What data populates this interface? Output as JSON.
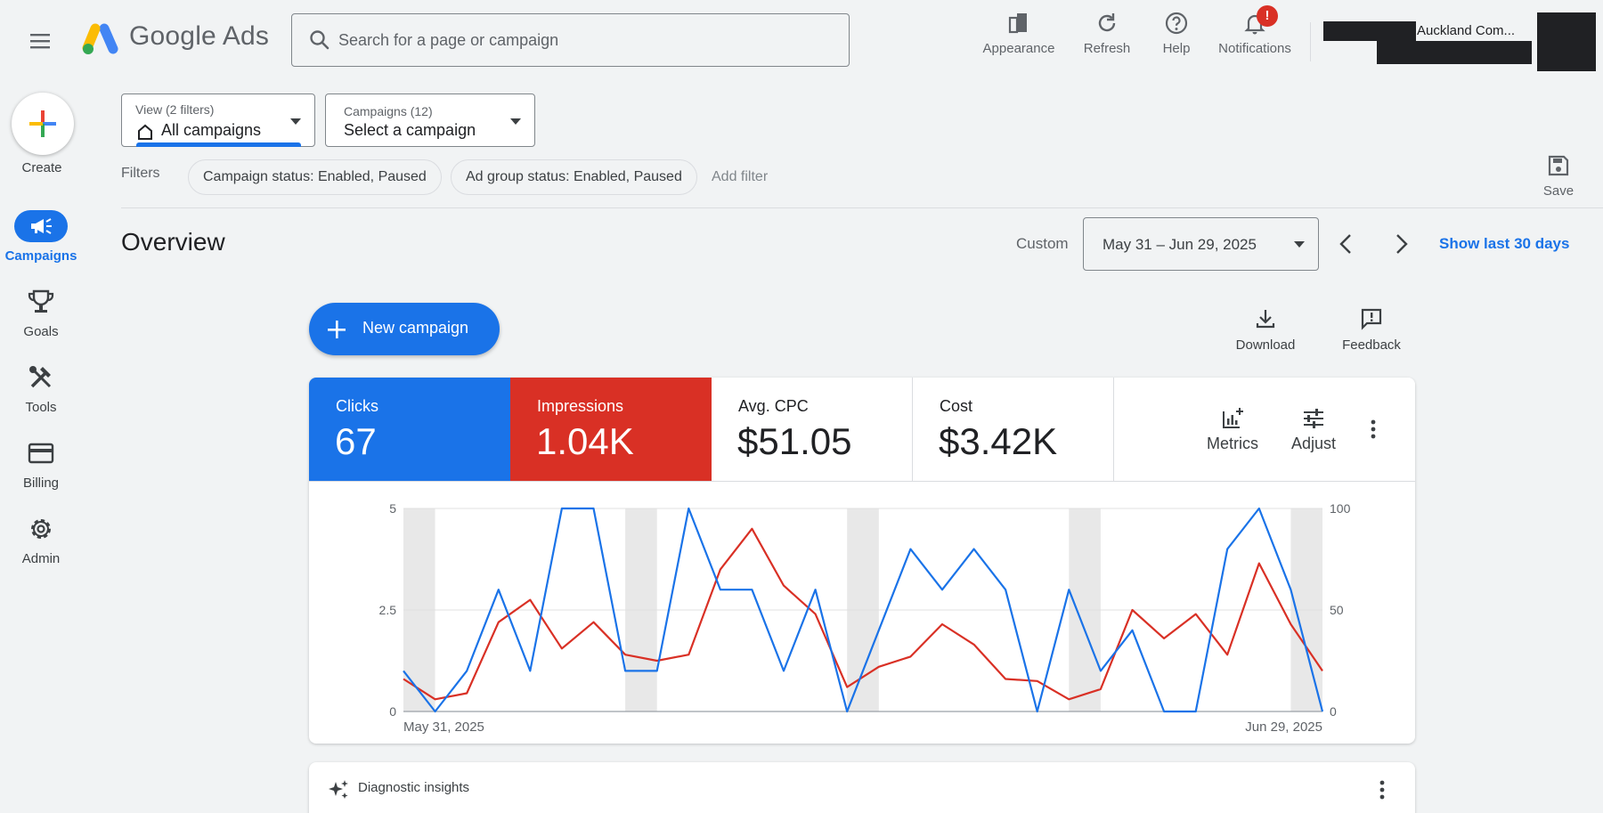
{
  "app": {
    "product_name": "Google Ads"
  },
  "search": {
    "placeholder": "Search for a page or campaign"
  },
  "header": {
    "appearance_label": "Appearance",
    "refresh_label": "Refresh",
    "help_label": "Help",
    "notifications_label": "Notifications",
    "notifications_badge": "!",
    "account_name": "Auckland Com..."
  },
  "nav": {
    "create_label": "Create",
    "items": [
      {
        "label": "Campaigns",
        "icon": "megaphone-icon",
        "active": true
      },
      {
        "label": "Goals",
        "icon": "trophy-icon"
      },
      {
        "label": "Tools",
        "icon": "tools-icon"
      },
      {
        "label": "Billing",
        "icon": "credit-card-icon"
      },
      {
        "label": "Admin",
        "icon": "gear-icon"
      }
    ]
  },
  "pickers": {
    "view_small": "View (2 filters)",
    "view_value": "All campaigns",
    "campaign_small": "Campaigns (12)",
    "campaign_value": "Select a campaign"
  },
  "filters": {
    "label": "Filters",
    "chips": [
      "Campaign status: Enabled, Paused",
      "Ad group status: Enabled, Paused"
    ],
    "add_filter": "Add filter",
    "save_label": "Save"
  },
  "overview": {
    "title": "Overview",
    "custom_label": "Custom",
    "date_range": "May 31 – Jun 29, 2025",
    "show_last": "Show last 30 days"
  },
  "actions": {
    "new_campaign": "New campaign",
    "download": "Download",
    "feedback": "Feedback"
  },
  "metrics": {
    "clicks_label": "Clicks",
    "clicks_value": "67",
    "impressions_label": "Impressions",
    "impressions_value": "1.04K",
    "cpc_label": "Avg. CPC",
    "cpc_value": "$51.05",
    "cost_label": "Cost",
    "cost_value": "$3.42K",
    "metrics_btn": "Metrics",
    "adjust_btn": "Adjust"
  },
  "diagnostic": {
    "label": "Diagnostic insights"
  },
  "colors": {
    "blue": "#1a73e8",
    "red": "#d93025"
  },
  "chart_data": {
    "type": "line",
    "x_start_label": "May 31, 2025",
    "x_end_label": "Jun 29, 2025",
    "left_ticks": [
      "0",
      "2.5",
      "5"
    ],
    "right_ticks": [
      "0",
      "50",
      "100"
    ],
    "ylim_left": [
      0,
      5
    ],
    "ylim_right": [
      0,
      100
    ],
    "weekend_day_indices": [
      0,
      7,
      14,
      21,
      28
    ],
    "series": [
      {
        "name": "Clicks",
        "axis": "left",
        "color": "#1a73e8",
        "values": [
          1,
          0,
          1,
          3,
          1,
          5,
          5,
          1,
          1,
          5,
          3,
          3,
          1,
          3,
          0,
          2,
          4,
          3,
          4,
          3,
          0,
          3,
          1,
          2,
          0,
          0,
          4,
          5,
          3,
          0
        ]
      },
      {
        "name": "Impressions",
        "axis": "right",
        "color": "#d93025",
        "values": [
          16,
          6,
          9,
          44,
          55,
          31,
          44,
          28,
          25,
          28,
          70,
          90,
          62,
          48,
          12,
          22,
          27,
          43,
          33,
          16,
          15,
          6,
          11,
          50,
          36,
          48,
          28,
          73,
          43,
          20
        ]
      }
    ]
  }
}
